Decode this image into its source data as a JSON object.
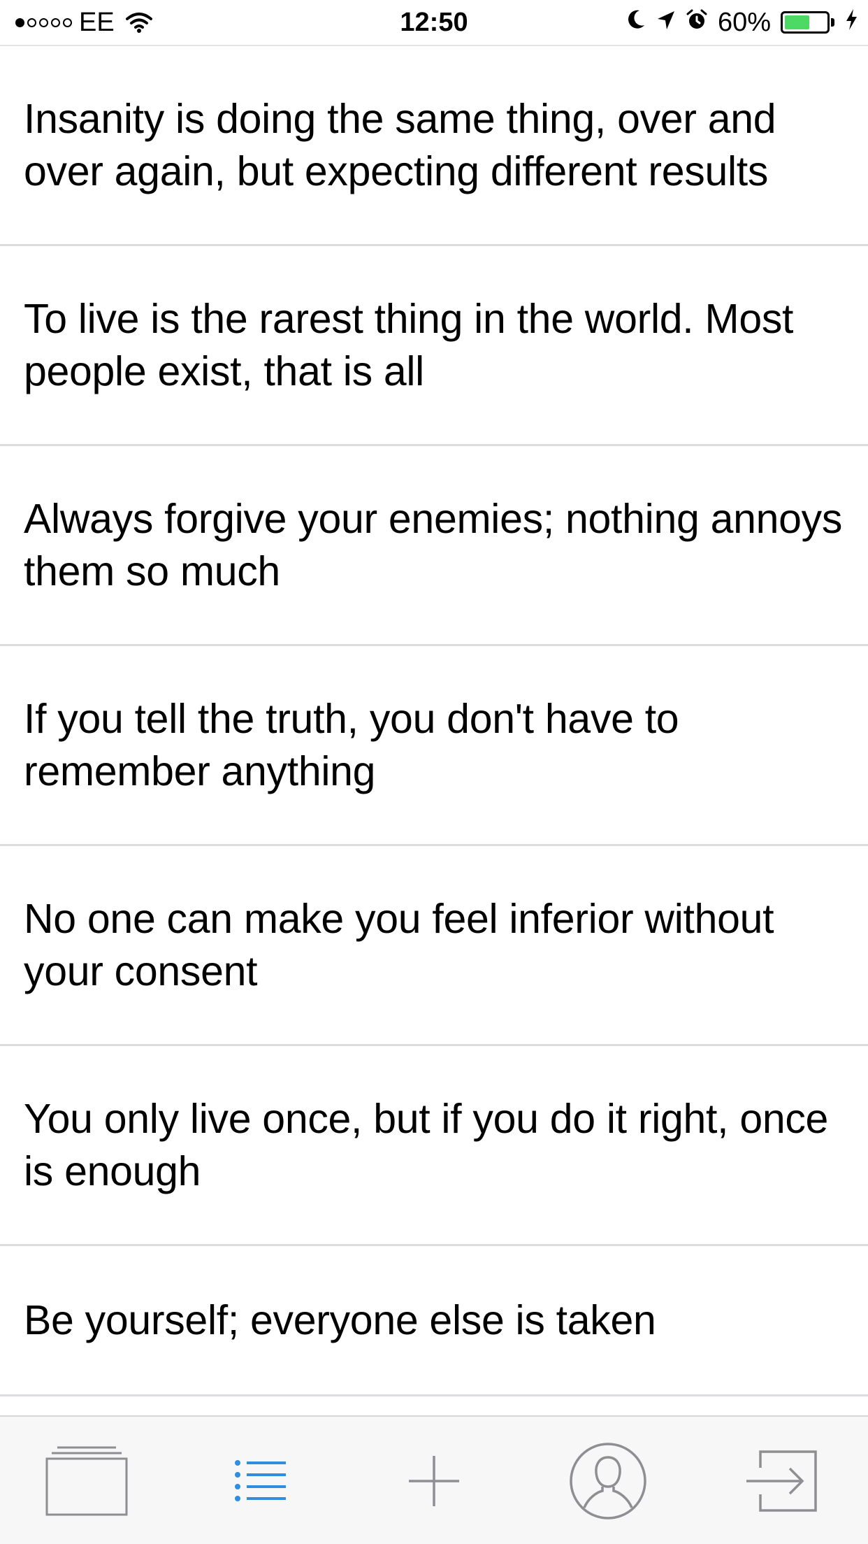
{
  "status_bar": {
    "carrier": "EE",
    "time": "12:50",
    "battery_percent_label": "60%",
    "battery_level": 0.6,
    "signal_bars_filled": 1,
    "signal_bars_total": 5
  },
  "quotes": [
    {
      "text": "Insanity is doing the same thing, over and over again, but expecting different results"
    },
    {
      "text": "To live is the rarest thing in the world. Most people exist, that is all"
    },
    {
      "text": "Always forgive your enemies; nothing annoys them so much"
    },
    {
      "text": "If you tell the truth, you don't have to remember anything"
    },
    {
      "text": "No one can make you feel inferior without your consent"
    },
    {
      "text": "You only live once, but if you do it right, once is enough"
    },
    {
      "text": "Be yourself; everyone else is taken"
    }
  ],
  "tab_bar": {
    "tabs": [
      {
        "icon": "cards-icon",
        "active": false
      },
      {
        "icon": "list-icon",
        "active": true
      },
      {
        "icon": "plus-icon",
        "active": false
      },
      {
        "icon": "profile-icon",
        "active": false
      },
      {
        "icon": "logout-icon",
        "active": false
      }
    ],
    "active_color": "#2f8ee0",
    "inactive_color": "#8e8e93"
  },
  "colors": {
    "battery_fill": "#4cd964",
    "separator": "#dcdcde",
    "tab_bar_background": "#f7f7f7"
  }
}
